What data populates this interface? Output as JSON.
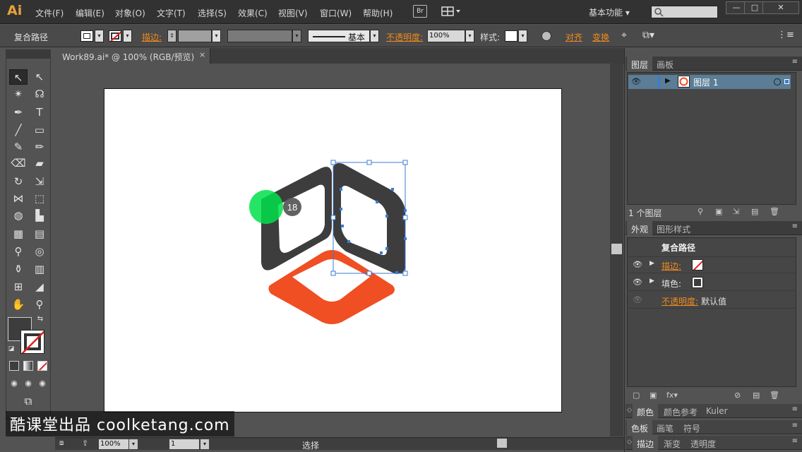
{
  "menubar": {
    "logo": "Ai",
    "items": [
      "文件(F)",
      "编辑(E)",
      "对象(O)",
      "文字(T)",
      "选择(S)",
      "效果(C)",
      "视图(V)",
      "窗口(W)",
      "帮助(H)"
    ],
    "bridge": "Br",
    "workspace": "基本功能",
    "window_buttons": [
      "—",
      "□",
      "✕"
    ]
  },
  "controlbar": {
    "selection_type": "复合路径",
    "stroke_label": "描边:",
    "stroke_profile": "基本",
    "opacity_label": "不透明度:",
    "opacity_value": "100%",
    "style_label": "样式:",
    "align_label": "对齐",
    "transform_label": "变换"
  },
  "document": {
    "tab_title": "Work89.ai* @ 100% (RGB/预览)",
    "close": "×"
  },
  "statusbar": {
    "zoom": "100%",
    "page": "1",
    "tool": "选择"
  },
  "layers_panel": {
    "tabs": [
      "图层",
      "画板"
    ],
    "layer_name": "图层 1",
    "count": "1 个图层"
  },
  "appearance_panel": {
    "tabs": [
      "外观",
      "图形样式"
    ],
    "title": "复合路径",
    "rows": [
      {
        "label": "描边:"
      },
      {
        "label": "填色:"
      },
      {
        "label": "不透明度:",
        "value": "默认值"
      }
    ]
  },
  "bottom_panels": {
    "color_tabs": [
      "颜色",
      "颜色参考",
      "Kuler"
    ],
    "swatch_tabs": [
      "色板",
      "画笔",
      "符号"
    ],
    "stroke_tabs": [
      "描边",
      "渐变",
      "透明度"
    ]
  },
  "cursor_badge": "18",
  "watermark": "酷课堂出品 coolketang.com",
  "colors": {
    "dark_shape": "#3d3d3d",
    "orange_shape": "#f04e23",
    "selection": "#3a7bd5",
    "cursor_highlight": "#00e04a",
    "accent_orange": "#f08a1c"
  }
}
